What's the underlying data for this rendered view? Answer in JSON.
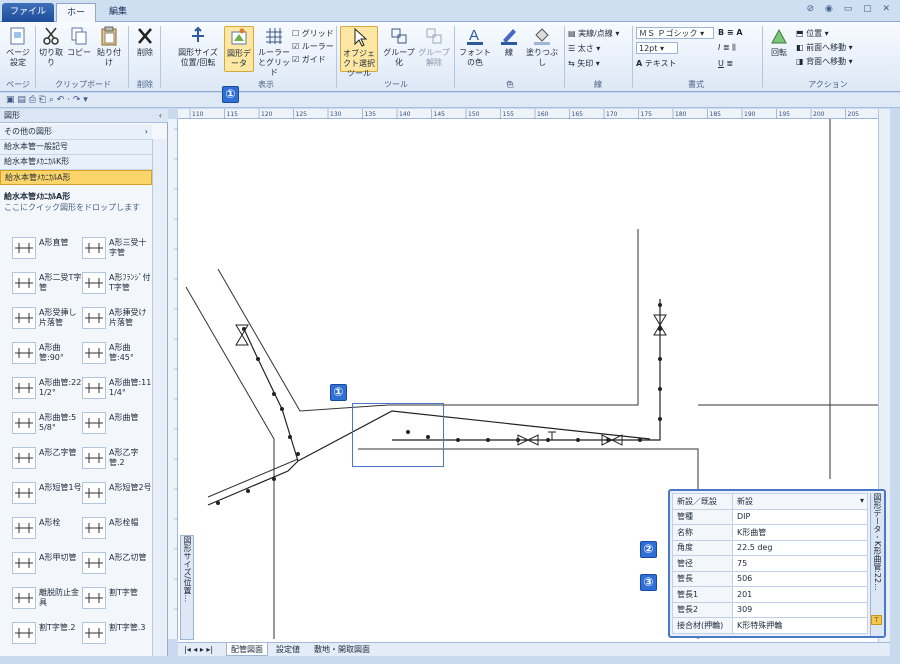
{
  "ribbon": {
    "tabs": [
      "ファイル",
      "ホーム",
      "編集"
    ],
    "page_setup": "ページ設定",
    "cut": "切り取り",
    "copy": "コピー",
    "paste": "貼り付け",
    "delete": "削除",
    "shape_size": "図形サイズ位置/回転",
    "shape_data": "図形データ",
    "ruler_grid": "ルーラーとグリッド",
    "check_grid": "グリッド",
    "check_ruler": "ルーラー",
    "check_guide": "ガイド",
    "select_tool": "オブジェクト選択ツール",
    "group": "グループ化",
    "ungroup": "グループ解除",
    "font_color": "フォントの色",
    "line": "線",
    "fill": "塗りつぶし",
    "line_style": "実線/点線",
    "line_weight": "太さ",
    "arrow": "矢印",
    "font_name": "ＭＳ Ｐゴシック",
    "font_size": "12pt",
    "text": "テキスト",
    "rotate": "回転",
    "position": "位置",
    "bring_front": "前面へ移動",
    "send_back": "背面へ移動",
    "groups": {
      "page": "ページ",
      "clipboard": "クリップボード",
      "delete": "削除",
      "display": "表示",
      "tools": "ツール",
      "color": "色",
      "line": "線",
      "format": "書式",
      "action": "アクション"
    }
  },
  "shapes_panel": {
    "header": "図形",
    "stencils": [
      "その他の図形",
      "給水本管一般記号",
      "給水本管ﾒｶﾆｶﾙK形",
      "給水本管ﾒｶﾆｶﾙA形"
    ],
    "title": "給水本管ﾒｶﾆｶﾙA形",
    "hint": "ここにクイック図形をドロップします",
    "shapes": [
      "A形直管",
      "A形三受十字管",
      "A形二受T字管",
      "A形ﾌﾗﾝｼﾞ付T字管",
      "A形受挿し片落管",
      "A形挿受け片落管",
      "A形曲管:90°",
      "A形曲管:45°",
      "A形曲管:22 1/2°",
      "A形曲管:11 1/4°",
      "A形曲管:5 5/8°",
      "A形曲管",
      "A形乙字管",
      "A形乙字管.2",
      "A形短管1号",
      "A形短管2号",
      "A形栓",
      "A形栓帽",
      "A形甲切管",
      "A形乙切管",
      "離脱防止金具",
      "割T字管",
      "割T字管.2",
      "割T字管.3"
    ]
  },
  "size_window_tab": "図形サイズ/位置...",
  "page_tabs": [
    "配管図面",
    "設定値",
    "敷地・開取図面"
  ],
  "shape_data": {
    "side_title": "図形データ - K形曲管:22...",
    "rows": [
      {
        "key": "新設／既設",
        "value": "新設"
      },
      {
        "key": "管種",
        "value": "DIP"
      },
      {
        "key": "名称",
        "value": "K形曲管"
      },
      {
        "key": "角度",
        "value": "22.5 deg"
      },
      {
        "key": "管径",
        "value": "75"
      },
      {
        "key": "管長",
        "value": "506"
      },
      {
        "key": "管長1",
        "value": "201"
      },
      {
        "key": "管長2",
        "value": "309"
      },
      {
        "key": "接合材(押輪)",
        "value": "K形特殊押輪"
      }
    ]
  },
  "markers": [
    "①",
    "②",
    "③"
  ],
  "ruler_labels": [
    "110",
    "115",
    "120",
    "125",
    "130",
    "135",
    "140",
    "145",
    "150",
    "155",
    "160",
    "165",
    "170",
    "175",
    "180",
    "185",
    "190",
    "195",
    "200",
    "205"
  ]
}
